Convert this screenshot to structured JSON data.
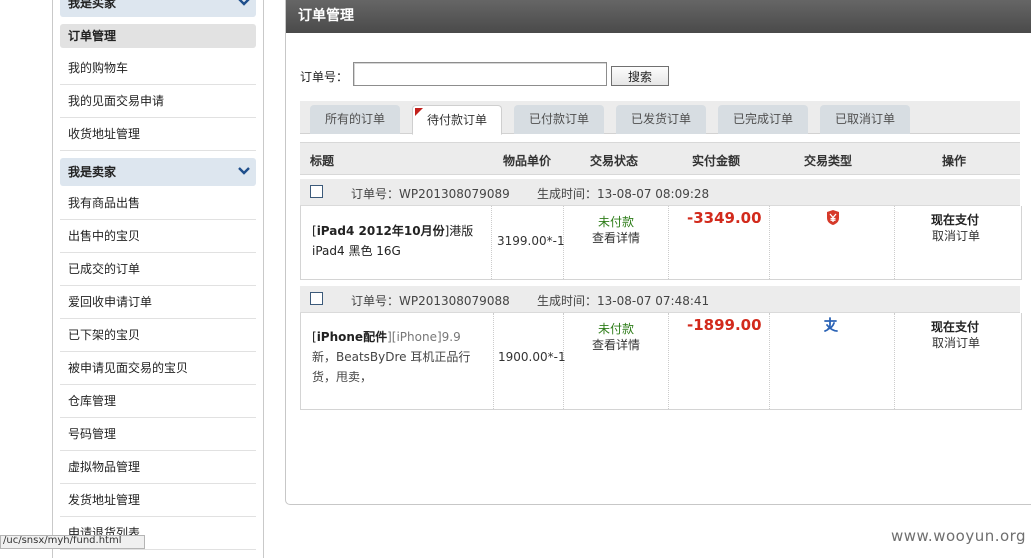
{
  "sidebar": {
    "buyer_header": "我是买家",
    "buyer_items": [
      "订单管理",
      "我的购物车",
      "我的见面交易申请",
      "收货地址管理"
    ],
    "seller_header": "我是卖家",
    "seller_items": [
      "我有商品出售",
      "出售中的宝贝",
      "已成交的订单",
      "爱回收申请订单",
      "已下架的宝贝",
      "被申请见面交易的宝贝",
      "仓库管理",
      "号码管理",
      "虚拟物品管理",
      "发货地址管理",
      "申请退货列表"
    ]
  },
  "status_url": "/uc/snsx/myh/fund.html",
  "panel": {
    "title": "订单管理",
    "search_label": "订单号：",
    "search_value": "",
    "search_button": "搜索"
  },
  "tabs": [
    "所有的订单",
    "待付款订单",
    "已付款订单",
    "已发货订单",
    "已完成订单",
    "已取消订单"
  ],
  "active_tab": "待付款订单",
  "table_headers": {
    "title": "标题",
    "unit_price": "物品单价",
    "status": "交易状态",
    "paid_amount": "实付金额",
    "type": "交易类型",
    "actions": "操作"
  },
  "orders": [
    {
      "order_no": "订单号：WP201308079089",
      "created": "生成时间：13-08-07 08:09:28",
      "title_open": "[",
      "title_bold": "iPad4 2012年10月份",
      "title_tail": "]港版",
      "title_line2": "iPad4 黑色 16G",
      "unit_price": "3199.00*-1",
      "status": "未付款",
      "detail": "查看详情",
      "amount": "-3349.00",
      "type_icon": "shield-yen-icon",
      "pay": "现在支付",
      "cancel": "取消订单"
    },
    {
      "order_no": "订单号：WP201308079088",
      "created": "生成时间：13-08-07 07:48:41",
      "title_open": "[",
      "title_bold": "iPhone配件",
      "title_tail": "][iPhone]9.9",
      "title_line2": "新，BeatsByDre 耳机正品行",
      "title_line3": "货，甩卖，",
      "unit_price": "1900.00*-1",
      "status": "未付款",
      "detail": "查看详情",
      "amount": "-1899.00",
      "type_icon": "alipay-icon",
      "pay": "现在支付",
      "cancel": "取消订单"
    }
  ],
  "watermark": "www.wooyun.org",
  "colors": {
    "accent_red": "#d22a1c",
    "unpaid_green": "#2e7d19",
    "header_dark": "#555555",
    "sidebar_section": "#dde6ef"
  }
}
